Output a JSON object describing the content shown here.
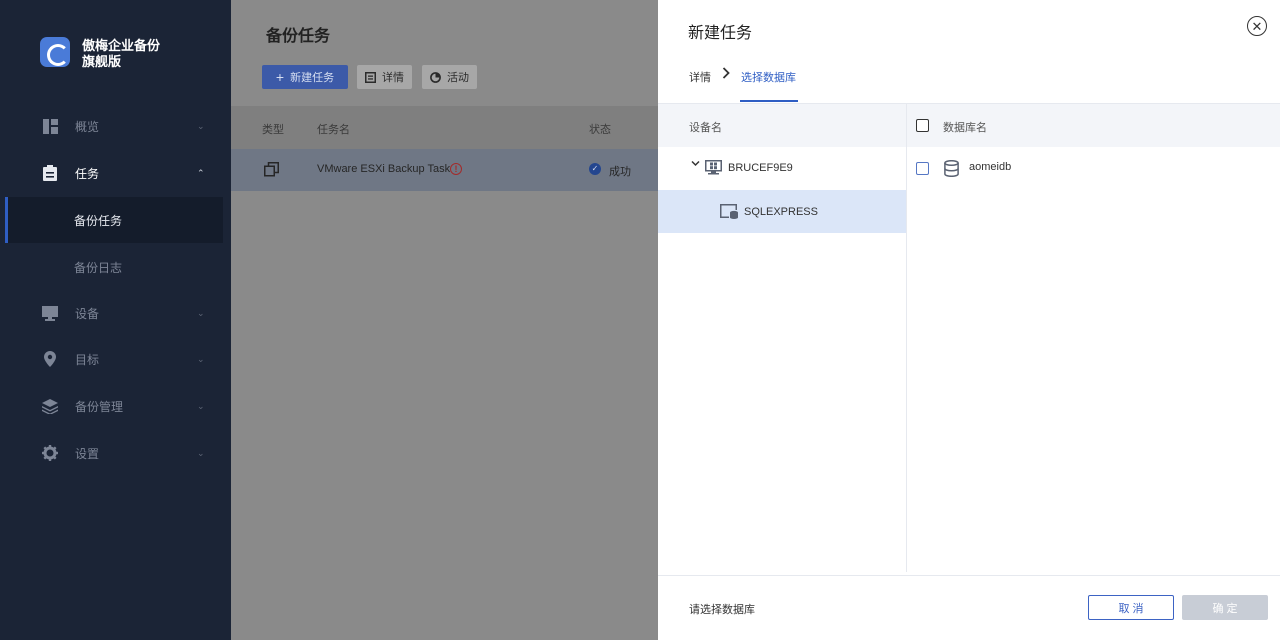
{
  "sidebar": {
    "brand_line1": "傲梅企业备份",
    "brand_line2": "旗舰版",
    "items": [
      {
        "label": "概览",
        "icon": "dashboard-icon"
      },
      {
        "label": "任务",
        "icon": "task-icon"
      },
      {
        "label": "备份任务"
      },
      {
        "label": "备份日志"
      },
      {
        "label": "设备",
        "icon": "monitor-icon"
      },
      {
        "label": "目标",
        "icon": "location-pin-icon"
      },
      {
        "label": "备份管理",
        "icon": "layers-icon"
      },
      {
        "label": "设置",
        "icon": "gear-icon"
      }
    ]
  },
  "main": {
    "title": "备份任务",
    "toolbar": {
      "new_task": "新建任务",
      "details": "详情",
      "activity": "活动"
    },
    "table": {
      "headers": [
        "类型",
        "任务名",
        "状态"
      ],
      "rows": [
        {
          "name": "VMware ESXi Backup Task",
          "status": "成功"
        }
      ]
    }
  },
  "panel": {
    "title": "新建任务",
    "steps": [
      "详情",
      "选择数据库"
    ],
    "left_header": "设备名",
    "right_header": "数据库名",
    "tree": [
      {
        "label": "BRUCEF9E9"
      },
      {
        "label": "SQLEXPRESS"
      }
    ],
    "databases": [
      {
        "label": "aomeidb"
      }
    ],
    "footer_hint": "请选择数据库",
    "cancel_label": "取 消",
    "ok_label": "确 定"
  },
  "colors": {
    "accent": "#2f5ec4",
    "sidebar_bg": "#1b2436",
    "selected_row": "#dbe6f8"
  }
}
